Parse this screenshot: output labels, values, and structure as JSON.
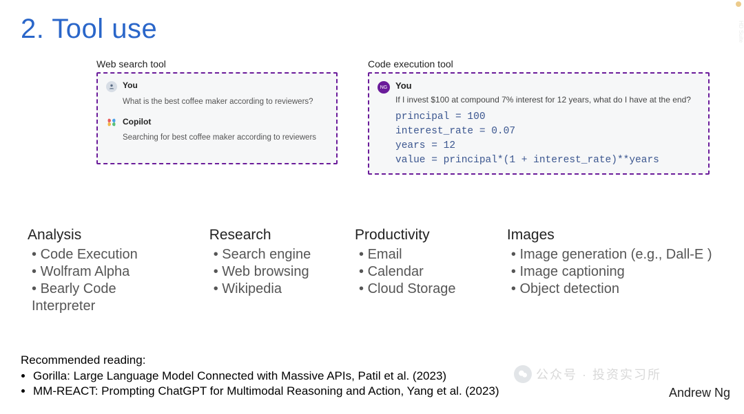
{
  "title": "2. Tool use",
  "panels": {
    "web": {
      "label": "Web search tool",
      "you_label": "You",
      "you_msg": "What is the best coffee maker according to reviewers?",
      "copilot_label": "Copilot",
      "copilot_msg": "Searching for best coffee maker according to reviewers"
    },
    "code": {
      "label": "Code execution tool",
      "avatar_initials": "NG",
      "you_label": "You",
      "you_msg": "If I invest $100 at compound 7% interest for 12 years, what do I have at the end?",
      "code": "principal = 100\ninterest_rate = 0.07\nyears = 12\nvalue = principal*(1 + interest_rate)**years"
    }
  },
  "columns": {
    "analysis": {
      "title": "Analysis",
      "items": [
        "Code Execution",
        "Wolfram Alpha",
        "Bearly Code Interpreter"
      ]
    },
    "research": {
      "title": "Research",
      "items": [
        "Search engine",
        "Web browsing",
        "Wikipedia"
      ]
    },
    "productivity": {
      "title": "Productivity",
      "items": [
        "Email",
        "Calendar",
        "Cloud Storage"
      ]
    },
    "images": {
      "title": "Images",
      "items": [
        "Image generation (e.g., Dall-E )",
        "Image captioning",
        "Object detection"
      ]
    }
  },
  "reading": {
    "heading": "Recommended reading:",
    "items": [
      "Gorilla: Large Language Model Connected with Massive APIs, Patil et al. (2023)",
      "MM-REACT: Prompting ChatGPT for Multimodal Reasoning and Action, Yang et al. (2023)"
    ]
  },
  "author": "Andrew Ng",
  "watermark": "公众号 · 投资实习所",
  "sidebar_hint": "HD Suite"
}
